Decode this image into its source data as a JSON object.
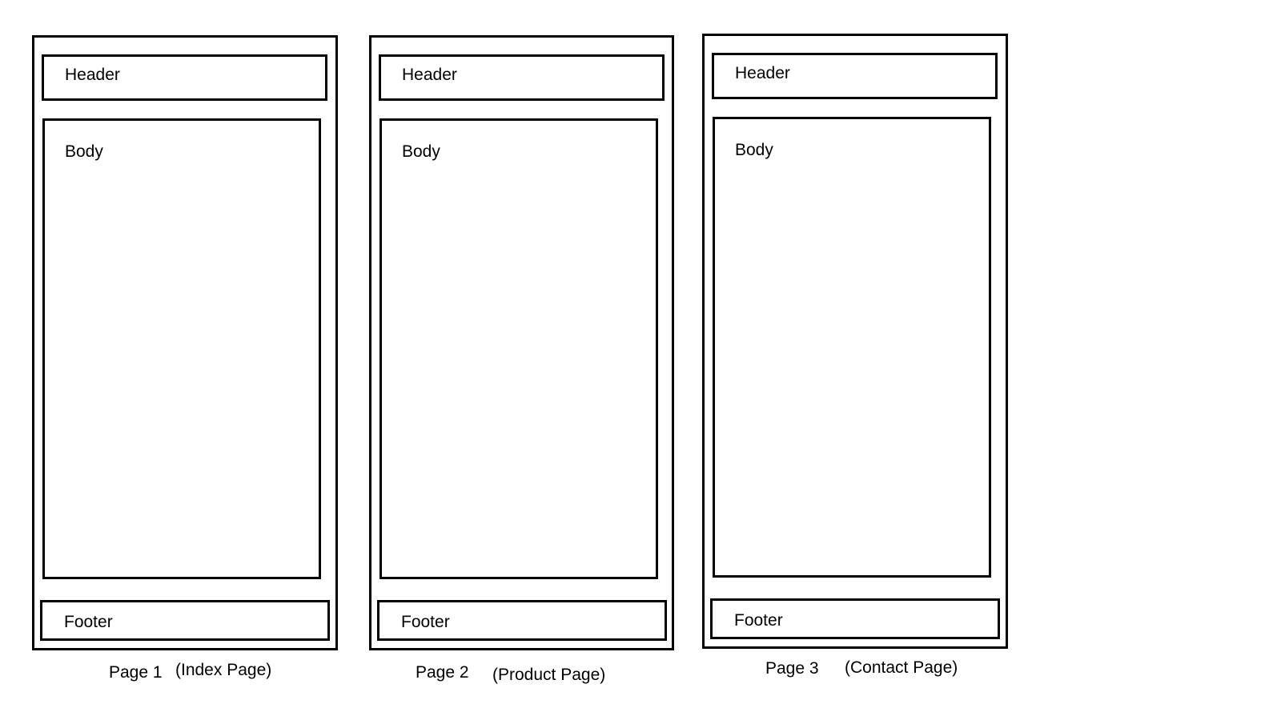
{
  "pages": [
    {
      "header_label": "Header",
      "body_label": "Body",
      "footer_label": "Footer",
      "caption_page": "Page 1",
      "caption_name": "(Index Page)"
    },
    {
      "header_label": "Header",
      "body_label": "Body",
      "footer_label": "Footer",
      "caption_page": "Page 2",
      "caption_name": "(Product Page)"
    },
    {
      "header_label": "Header",
      "body_label": "Body",
      "footer_label": "Footer",
      "caption_page": "Page 3",
      "caption_name": "(Contact Page)"
    }
  ],
  "colors": {
    "stroke": "#000000",
    "background": "#ffffff"
  }
}
